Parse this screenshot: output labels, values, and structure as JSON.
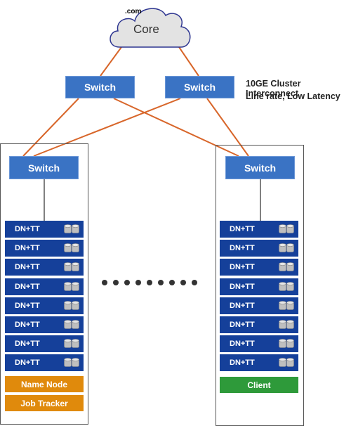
{
  "watermark": ".com",
  "core": {
    "label": "Core"
  },
  "top_switches": [
    {
      "label": "Switch"
    },
    {
      "label": "Switch"
    }
  ],
  "interconnect": {
    "line1": "10GE Cluster Interconnect",
    "line2": "Line rate, Low Latency"
  },
  "colors": {
    "link": "#d8662a",
    "switch": "#3a73c4",
    "node": "#15409a",
    "master": "#e08a0c",
    "client": "#2e9a3a"
  },
  "left_rack": {
    "switch": "Switch",
    "nodes": [
      "DN+TT",
      "DN+TT",
      "DN+TT",
      "DN+TT",
      "DN+TT",
      "DN+TT",
      "DN+TT",
      "DN+TT"
    ],
    "roles": [
      "Name Node",
      "Job Tracker"
    ]
  },
  "right_rack": {
    "switch": "Switch",
    "nodes": [
      "DN+TT",
      "DN+TT",
      "DN+TT",
      "DN+TT",
      "DN+TT",
      "DN+TT",
      "DN+TT",
      "DN+TT"
    ],
    "roles": [
      "Client"
    ]
  },
  "ellipsis_dots": 9
}
